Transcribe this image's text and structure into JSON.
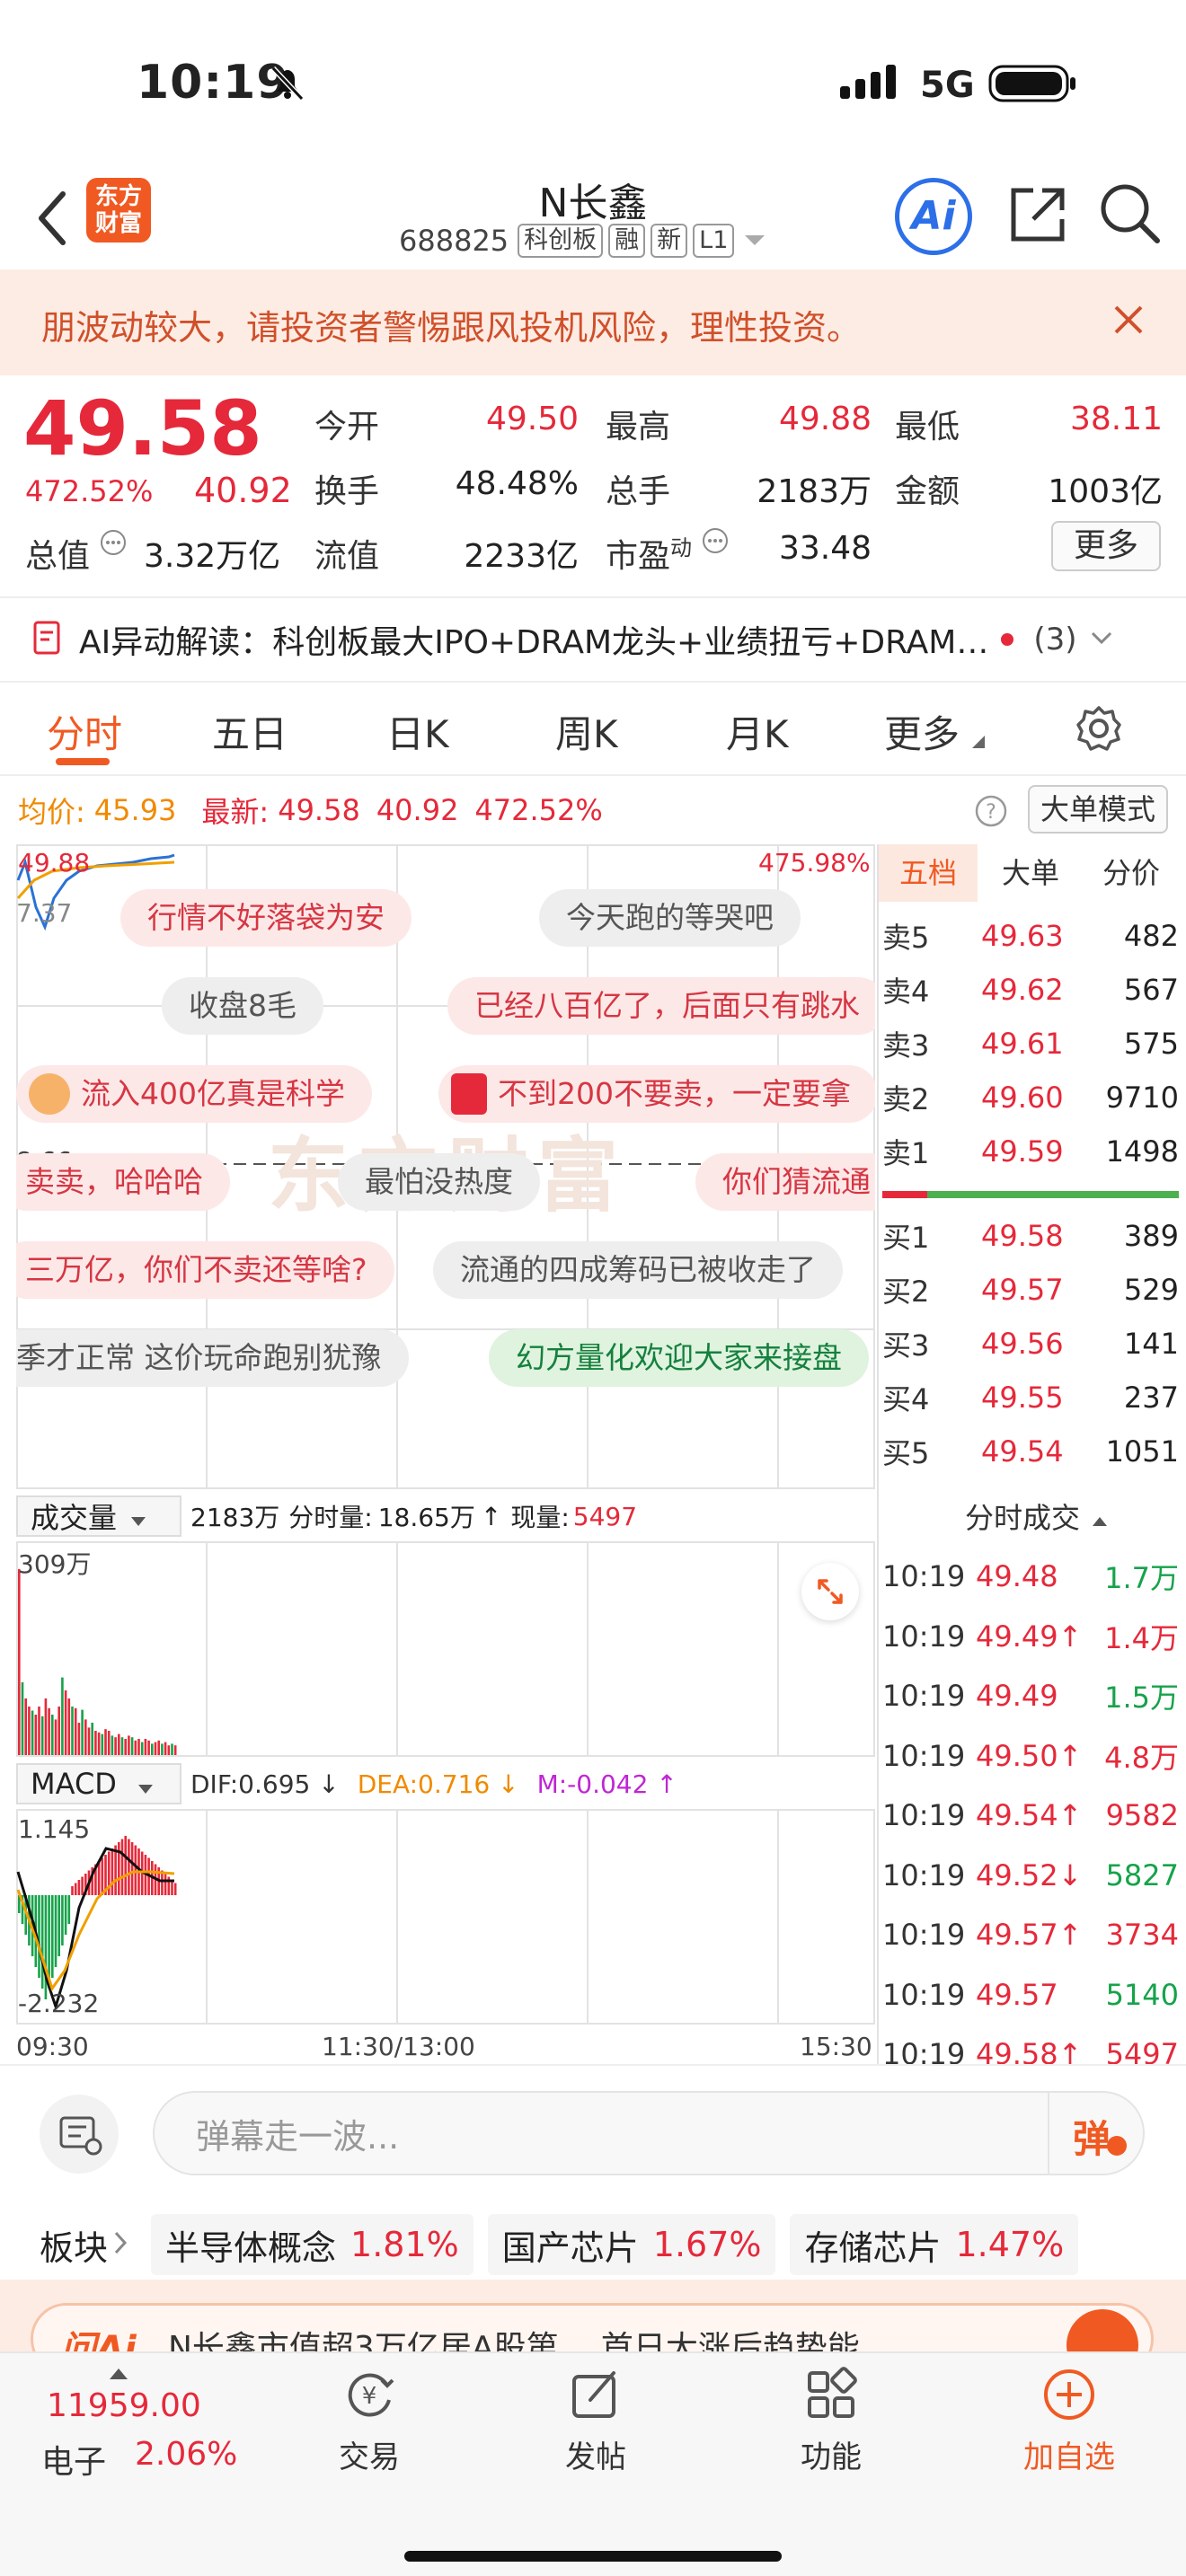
{
  "status": {
    "time": "10:19",
    "network": "5G"
  },
  "header": {
    "title": "N长鑫",
    "code": "688825",
    "tags": [
      "科创板",
      "融",
      "新",
      "L1"
    ],
    "logo_line1": "东方",
    "logo_line2": "财富",
    "ai_label": "Ai"
  },
  "banner": {
    "text": "朋波动较大，请投资者警惕跟风投机风险，理性投资。"
  },
  "quote": {
    "price": "49.58",
    "pct": "472.52%",
    "chg": "40.92",
    "open_label": "今开",
    "open": "49.50",
    "high_label": "最高",
    "high": "49.88",
    "low_label": "最低",
    "low": "38.11",
    "turnover_label": "换手",
    "turnover": "48.48%",
    "vol_label": "总手",
    "vol": "2183万",
    "amount_label": "金额",
    "amount": "1003亿",
    "mcap_label": "总值",
    "mcap": "3.32万亿",
    "float_label": "流值",
    "float": "2233亿",
    "pe_label": "市盈",
    "pe_sup": "动",
    "pe": "33.48",
    "more": "更多"
  },
  "ai": {
    "text": "AI异动解读：科创板最大IPO+DRAM龙头+业绩扭亏+DRAM…",
    "count": "(3)"
  },
  "tabs": [
    "分时",
    "五日",
    "日K",
    "周K",
    "月K",
    "更多"
  ],
  "chart": {
    "avg_label": "均价:",
    "avg": "45.93",
    "last_label": "最新:",
    "last": "49.58",
    "last_chg": "40.92",
    "last_pct": "472.52%",
    "big_mode": "大单模式",
    "top_left": "49.88",
    "top_right": "475.98%",
    "mid_left": "8.66",
    "low_left": "7.37",
    "watermark": "东方财富"
  },
  "danmaku": [
    {
      "text": "行情不好落袋为安",
      "style": "pink"
    },
    {
      "text": "今天跑的等哭吧",
      "style": "gray"
    },
    {
      "text": "收盘8毛",
      "style": "gray"
    },
    {
      "text": "已经八百亿了，后面只有跳水",
      "style": "pink"
    },
    {
      "text": "流入400亿真是科学",
      "style": "pink"
    },
    {
      "text": "不到200不要卖，一定要拿",
      "style": "pink"
    },
    {
      "text": "卖卖，哈哈哈",
      "style": "pink"
    },
    {
      "text": "最怕没热度",
      "style": "gray"
    },
    {
      "text": "你们猜流通",
      "style": "pink"
    },
    {
      "text": "三万亿，你们不卖还等啥?",
      "style": "pink"
    },
    {
      "text": "流通的四成筹码已被收走了",
      "style": "gray"
    },
    {
      "text": "季才正常 这价玩命跑别犹豫",
      "style": "gray"
    },
    {
      "text": "幻方量化欢迎大家来接盘",
      "style": "green"
    }
  ],
  "orderbook": {
    "tabs": [
      "五档",
      "大单",
      "分价"
    ],
    "sell": [
      {
        "n": "卖5",
        "p": "49.63",
        "v": "482"
      },
      {
        "n": "卖4",
        "p": "49.62",
        "v": "567"
      },
      {
        "n": "卖3",
        "p": "49.61",
        "v": "575"
      },
      {
        "n": "卖2",
        "p": "49.60",
        "v": "9710"
      },
      {
        "n": "卖1",
        "p": "49.59",
        "v": "1498"
      }
    ],
    "buy": [
      {
        "n": "买1",
        "p": "49.58",
        "v": "389"
      },
      {
        "n": "买2",
        "p": "49.57",
        "v": "529"
      },
      {
        "n": "买3",
        "p": "49.56",
        "v": "141"
      },
      {
        "n": "买4",
        "p": "49.55",
        "v": "237"
      },
      {
        "n": "买5",
        "p": "49.54",
        "v": "1051"
      }
    ]
  },
  "volume": {
    "selector": "成交量",
    "total": "2183万",
    "tick_label": "分时量:",
    "tick": "18.65万",
    "arrow": "↑",
    "now_label": "现量:",
    "now": "5497",
    "max": "309万"
  },
  "macd": {
    "selector": "MACD",
    "dif": "DIF:0.695 ↓",
    "dea": "DEA:0.716 ↓",
    "m": "M:-0.042 ↑",
    "top": "1.145",
    "bottom": "-2.232"
  },
  "xaxis": {
    "start": "09:30",
    "mid": "11:30/13:00",
    "end": "15:30"
  },
  "trades": {
    "title": "分时成交",
    "rows": [
      {
        "t": "10:19",
        "p": "49.48",
        "v": "1.7万",
        "c": "green"
      },
      {
        "t": "10:19",
        "p": "49.49↑",
        "v": "1.4万",
        "c": "red"
      },
      {
        "t": "10:19",
        "p": "49.49",
        "v": "1.5万",
        "c": "green"
      },
      {
        "t": "10:19",
        "p": "49.50↑",
        "v": "4.8万",
        "c": "red"
      },
      {
        "t": "10:19",
        "p": "49.54↑",
        "v": "9582",
        "c": "red"
      },
      {
        "t": "10:19",
        "p": "49.52↓",
        "v": "5827",
        "c": "green"
      },
      {
        "t": "10:19",
        "p": "49.57↑",
        "v": "3734",
        "c": "red"
      },
      {
        "t": "10:19",
        "p": "49.57",
        "v": "5140",
        "c": "green"
      },
      {
        "t": "10:19",
        "p": "49.58↑",
        "v": "5497",
        "c": "red"
      }
    ]
  },
  "comment": {
    "placeholder": "弹幕走一波...",
    "send": "弹"
  },
  "sectors": {
    "label": "板块",
    "items": [
      {
        "name": "半导体概念",
        "pct": "1.81%"
      },
      {
        "name": "国产芯片",
        "pct": "1.67%"
      },
      {
        "name": "存储芯片",
        "pct": "1.47%"
      }
    ]
  },
  "news": {
    "ai": "问Ai",
    "text": "N长鑫市值超3万亿居A股第…   首日大涨后趋势能"
  },
  "bottom": {
    "index_value": "11959.00",
    "index_name": "电子",
    "index_pct": "2.06%",
    "nav": [
      "交易",
      "发帖",
      "功能",
      "加自选"
    ]
  }
}
